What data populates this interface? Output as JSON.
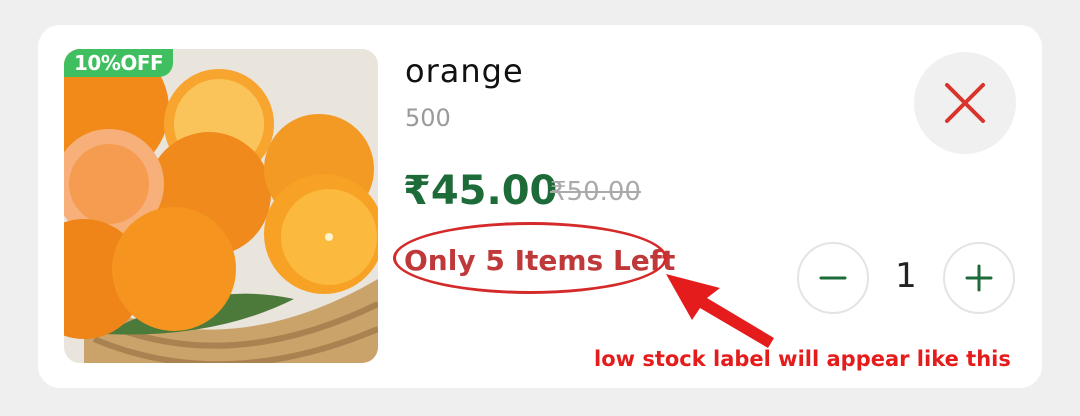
{
  "product": {
    "image_alt": "orange",
    "discount_badge": "10%OFF",
    "name": "orange",
    "weight": "500",
    "price": "₹45.00",
    "mrp": "₹50.00",
    "low_stock_label": "Only 5 Items Left"
  },
  "actions": {
    "remove_icon": "close-icon",
    "decrease_icon": "minus-icon",
    "increase_icon": "plus-icon"
  },
  "quantity": "1",
  "annotation": {
    "text": "low stock label will appear like this"
  },
  "colors": {
    "price": "#1e6b3a",
    "low_stock": "#c0393a",
    "annotation": "#e41c1c",
    "badge": "#3fbf5f"
  }
}
